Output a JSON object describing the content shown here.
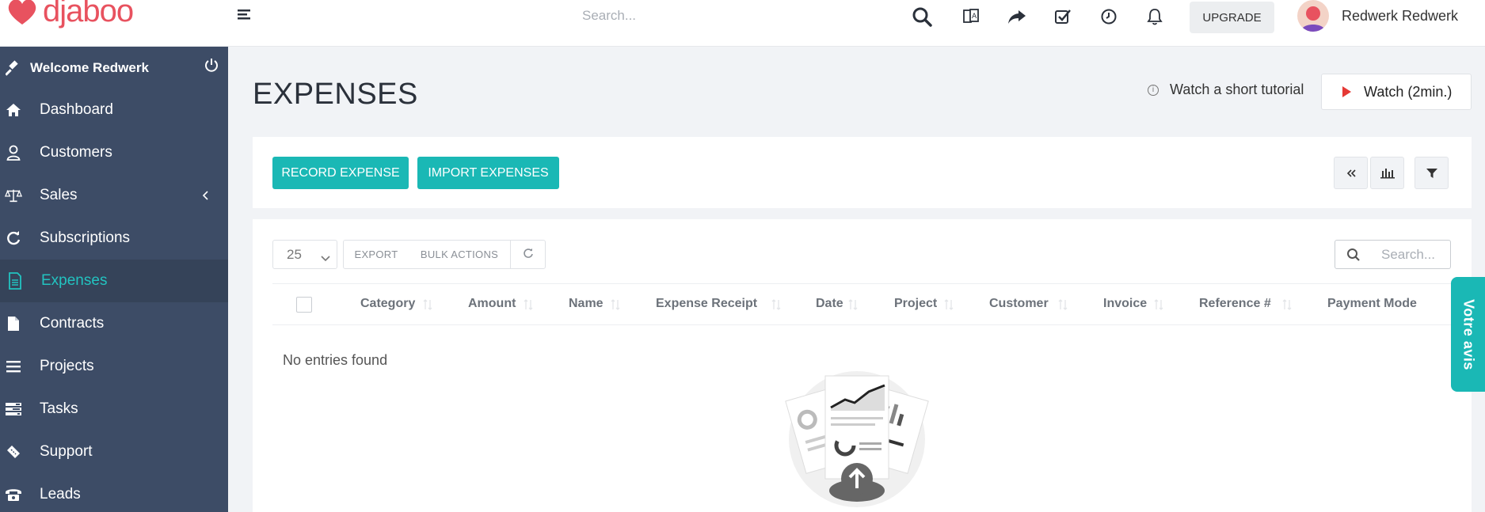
{
  "brand": {
    "logo_text": "djaboo",
    "color": "#e8525f"
  },
  "topbar": {
    "search_placeholder": "Search...",
    "icons": [
      "search-icon",
      "translate-icon",
      "share-icon",
      "tasks-check-icon",
      "clock-icon",
      "bell-icon"
    ],
    "upgrade_label": "UPGRADE",
    "user_name": "Redwerk Redwerk"
  },
  "sidebar": {
    "welcome": "Welcome Redwerk",
    "items": [
      {
        "label": "Dashboard",
        "icon": "home-icon"
      },
      {
        "label": "Customers",
        "icon": "user-icon"
      },
      {
        "label": "Sales",
        "icon": "balance-scale-icon"
      },
      {
        "label": "Subscriptions",
        "icon": "refresh-icon"
      },
      {
        "label": "Expenses",
        "icon": "file-text-icon",
        "active": true
      },
      {
        "label": "Contracts",
        "icon": "file-icon"
      },
      {
        "label": "Projects",
        "icon": "bars-icon"
      },
      {
        "label": "Tasks",
        "icon": "tasks-icon"
      },
      {
        "label": "Support",
        "icon": "ticket-icon"
      },
      {
        "label": "Leads",
        "icon": "phone-icon"
      }
    ],
    "accent": "#22c3c0",
    "background": "#3d4c66"
  },
  "main": {
    "title": "EXPENSES",
    "tutorial_text": "Watch a short tutorial",
    "watch_label": "Watch (2min.)",
    "record_label": "RECORD EXPENSE",
    "import_label": "IMPORT EXPENSES",
    "page_length": "25",
    "export_label": "EXPORT",
    "bulk_label": "BULK ACTIONS",
    "search_placeholder": "Search...",
    "columns": [
      "Category",
      "Amount",
      "Name",
      "Expense Receipt",
      "Date",
      "Project",
      "Customer",
      "Invoice",
      "Reference #",
      "Payment Mode"
    ],
    "empty_text": "No entries found",
    "feedback_label": "Votre avis",
    "teal": "#1ab8b5"
  }
}
